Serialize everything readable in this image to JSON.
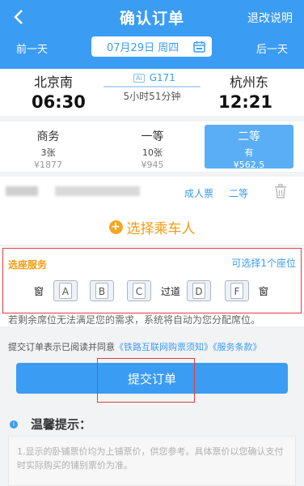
{
  "header": {
    "title": "确认订单",
    "refund_label": "退改说明",
    "prev_day": "前一天",
    "next_day": "后一天",
    "date": "07月29日 周四"
  },
  "train": {
    "from_station": "北京南",
    "from_time": "06:30",
    "to_station": "杭州东",
    "to_time": "12:21",
    "badge": "Ai",
    "number": "G171",
    "duration": "5小时51分钟"
  },
  "seat_classes": [
    {
      "name": "商务",
      "count": "3张",
      "price": "¥1877",
      "selected": false
    },
    {
      "name": "一等",
      "count": "10张",
      "price": "¥945",
      "selected": false
    },
    {
      "name": "二等",
      "count": "有",
      "price": "¥562.5",
      "selected": true
    }
  ],
  "passenger": {
    "ticket_type": "成人票",
    "seat_class": "二等",
    "add_label": "选择乘车人"
  },
  "seat_service": {
    "title": "选座服务",
    "tip": "可选择1个座位",
    "window": "窗",
    "aisle": "过道",
    "seats": [
      "A",
      "B",
      "C",
      "D",
      "F"
    ],
    "note": "若剩余席位无法满足您的需求，系统将自动为您分配席位。"
  },
  "agreement": {
    "prefix": "提交订单表示已阅读并同意",
    "link1": "《铁路互联网购票须知》",
    "link2": "《服务条款》"
  },
  "submit_label": "提交订单",
  "tips": {
    "title": "温馨提示：",
    "text": "1.显示的卧铺票价均为上铺票价，供您参考。具体票价以您确认支付时实际购买的铺别票价为准。"
  },
  "colors": {
    "primary": "#3b9cf3",
    "accent": "#f39c12",
    "highlight_border": "#e23c3c"
  }
}
